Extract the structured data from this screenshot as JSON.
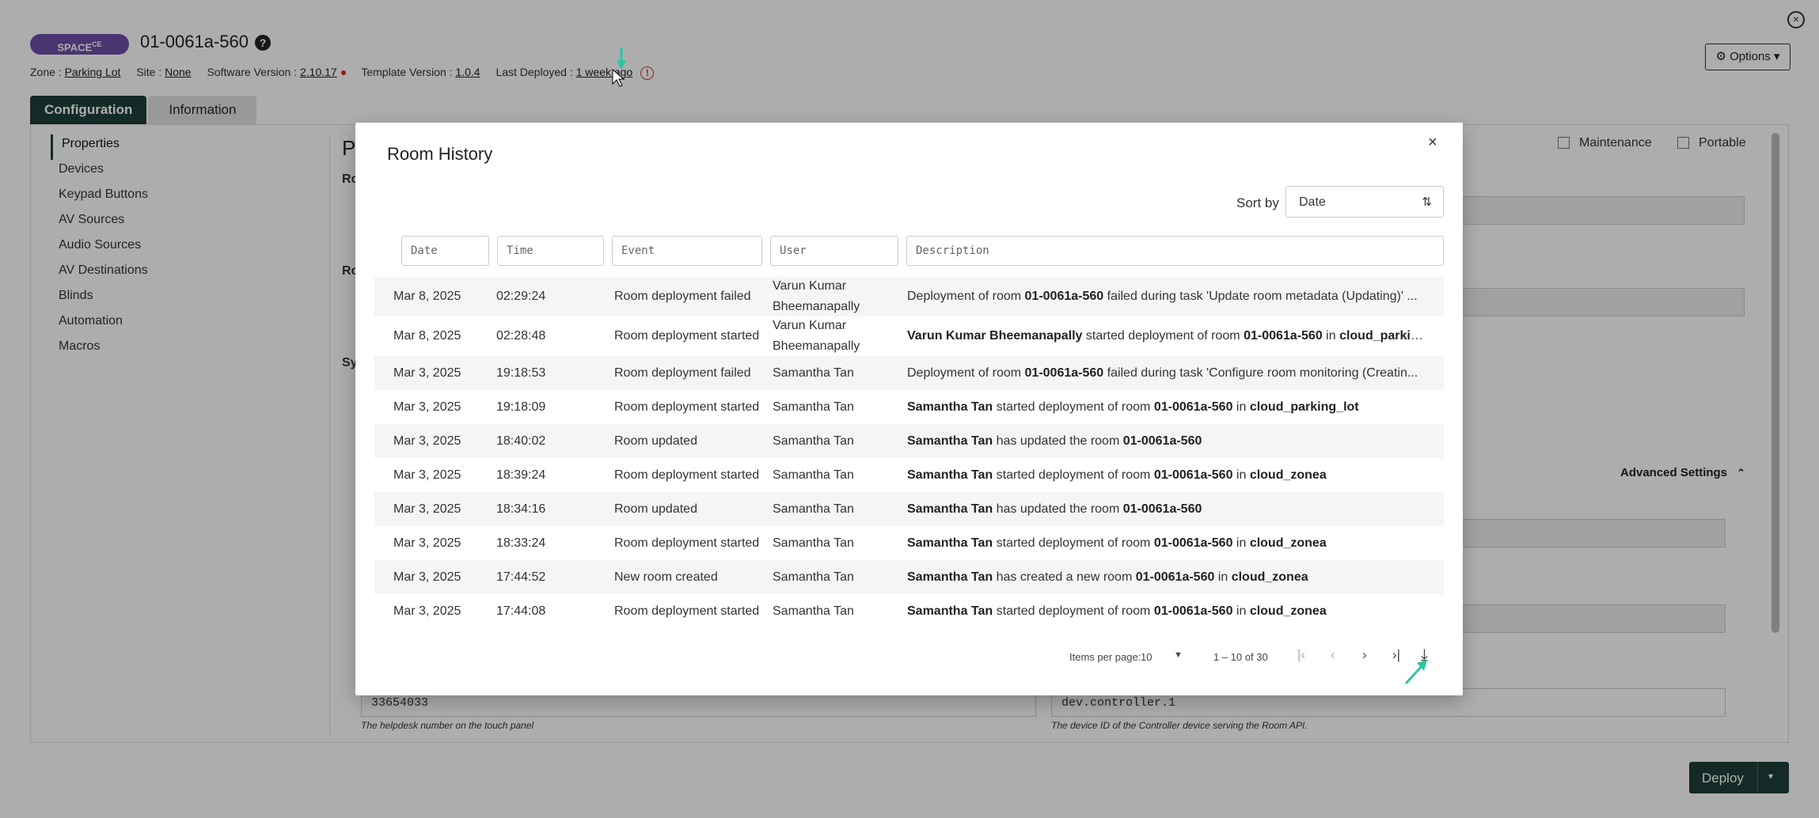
{
  "header": {
    "badge_label": "SPACE",
    "badge_sup": "CE",
    "room_name": "01-0061a-560",
    "help_symbol": "?",
    "close_symbol": "×",
    "zone_label": "Zone :",
    "zone_value": "Parking Lot",
    "site_label": "Site :",
    "site_value": "None",
    "software_label": "Software Version :",
    "software_value": "2.10.17",
    "template_label": "Template Version :",
    "template_value": "1.0.4",
    "deployed_label": "Last Deployed :",
    "deployed_value": "1 week ago",
    "warn_symbol": "!",
    "options_label": "Options"
  },
  "tabs": [
    {
      "label": "Configuration",
      "active": true
    },
    {
      "label": "Information",
      "active": false
    }
  ],
  "sidebar": {
    "items": [
      {
        "label": "Properties",
        "active": true
      },
      {
        "label": "Devices"
      },
      {
        "label": "Keypad Buttons"
      },
      {
        "label": "AV Sources"
      },
      {
        "label": "Audio Sources"
      },
      {
        "label": "AV Destinations"
      },
      {
        "label": "Blinds"
      },
      {
        "label": "Automation"
      },
      {
        "label": "Macros"
      }
    ]
  },
  "main": {
    "heading_fragment": "P",
    "label_fragments": [
      "Ro",
      "Ro",
      "Sy"
    ],
    "maintenance_label": "Maintenance",
    "portable_label": "Portable",
    "advanced_settings_label": "Advanced Settings",
    "helpdesk_value": "33654033",
    "helpdesk_hint": "The helpdesk number on the touch panel",
    "device_value": "dev.controller.1",
    "device_hint": "The device ID of the Controller device serving the Room API."
  },
  "deploy": {
    "label": "Deploy"
  },
  "modal": {
    "title": "Room History",
    "close_symbol": "×",
    "sort_label": "Sort by",
    "sort_value": "Date",
    "filters": {
      "date": "Date",
      "time": "Time",
      "event": "Event",
      "user": "User",
      "description": "Description"
    },
    "rows": [
      {
        "date": "Mar 8, 2025",
        "time": "02:29:24",
        "event": "Room deployment failed",
        "user": "Varun Kumar Bheemanapally",
        "desc": [
          [
            "",
            "Deployment of room "
          ],
          [
            "b",
            "01-0061a-560"
          ],
          [
            "",
            " failed during task 'Update room metadata (Updating)' ..."
          ]
        ]
      },
      {
        "date": "Mar 8, 2025",
        "time": "02:28:48",
        "event": "Room deployment started",
        "user": "Varun Kumar Bheemanapally",
        "desc": [
          [
            "b",
            "Varun Kumar Bheemanapally"
          ],
          [
            "",
            " started deployment of room "
          ],
          [
            "b",
            "01-0061a-560"
          ],
          [
            "",
            " in "
          ],
          [
            "b",
            "cloud_parkin..."
          ]
        ]
      },
      {
        "date": "Mar 3, 2025",
        "time": "19:18:53",
        "event": "Room deployment failed",
        "user": "Samantha Tan",
        "desc": [
          [
            "",
            "Deployment of room "
          ],
          [
            "b",
            "01-0061a-560"
          ],
          [
            "",
            " failed during task 'Configure room monitoring (Creatin..."
          ]
        ]
      },
      {
        "date": "Mar 3, 2025",
        "time": "19:18:09",
        "event": "Room deployment started",
        "user": "Samantha Tan",
        "desc": [
          [
            "b",
            "Samantha Tan"
          ],
          [
            "",
            " started deployment of room "
          ],
          [
            "b",
            "01-0061a-560"
          ],
          [
            "",
            " in "
          ],
          [
            "b",
            "cloud_parking_lot"
          ]
        ]
      },
      {
        "date": "Mar 3, 2025",
        "time": "18:40:02",
        "event": "Room updated",
        "user": "Samantha Tan",
        "desc": [
          [
            "b",
            "Samantha Tan"
          ],
          [
            "",
            " has updated the room "
          ],
          [
            "b",
            "01-0061a-560"
          ]
        ]
      },
      {
        "date": "Mar 3, 2025",
        "time": "18:39:24",
        "event": "Room deployment started",
        "user": "Samantha Tan",
        "desc": [
          [
            "b",
            "Samantha Tan"
          ],
          [
            "",
            " started deployment of room "
          ],
          [
            "b",
            "01-0061a-560"
          ],
          [
            "",
            " in "
          ],
          [
            "b",
            "cloud_zonea"
          ]
        ]
      },
      {
        "date": "Mar 3, 2025",
        "time": "18:34:16",
        "event": "Room updated",
        "user": "Samantha Tan",
        "desc": [
          [
            "b",
            "Samantha Tan"
          ],
          [
            "",
            " has updated the room "
          ],
          [
            "b",
            "01-0061a-560"
          ]
        ]
      },
      {
        "date": "Mar 3, 2025",
        "time": "18:33:24",
        "event": "Room deployment started",
        "user": "Samantha Tan",
        "desc": [
          [
            "b",
            "Samantha Tan"
          ],
          [
            "",
            " started deployment of room "
          ],
          [
            "b",
            "01-0061a-560"
          ],
          [
            "",
            " in "
          ],
          [
            "b",
            "cloud_zonea"
          ]
        ]
      },
      {
        "date": "Mar 3, 2025",
        "time": "17:44:52",
        "event": "New room created",
        "user": "Samantha Tan",
        "desc": [
          [
            "b",
            "Samantha Tan"
          ],
          [
            "",
            " has created a new room "
          ],
          [
            "b",
            "01-0061a-560"
          ],
          [
            "",
            " in "
          ],
          [
            "b",
            "cloud_zonea"
          ]
        ]
      },
      {
        "date": "Mar 3, 2025",
        "time": "17:44:08",
        "event": "Room deployment started",
        "user": "Samantha Tan",
        "desc": [
          [
            "b",
            "Samantha Tan"
          ],
          [
            "",
            " started deployment of room "
          ],
          [
            "b",
            "01-0061a-560"
          ],
          [
            "",
            " in "
          ],
          [
            "b",
            "cloud_zonea"
          ]
        ]
      }
    ],
    "paginator": {
      "items_label": "Items per page:",
      "items_value": "10",
      "range": "1 – 10 of 30"
    }
  },
  "icons": {
    "gear": "gear-icon",
    "sort": "sort-icon",
    "first_page": "first-page-icon",
    "prev_page": "prev-page-icon",
    "next_page": "next-page-icon",
    "last_page": "last-page-icon",
    "download": "download-icon"
  },
  "colors": {
    "accent": "#1e3f38",
    "badge": "#6d4fa8",
    "annotation_arrow": "#2ec4a6"
  }
}
